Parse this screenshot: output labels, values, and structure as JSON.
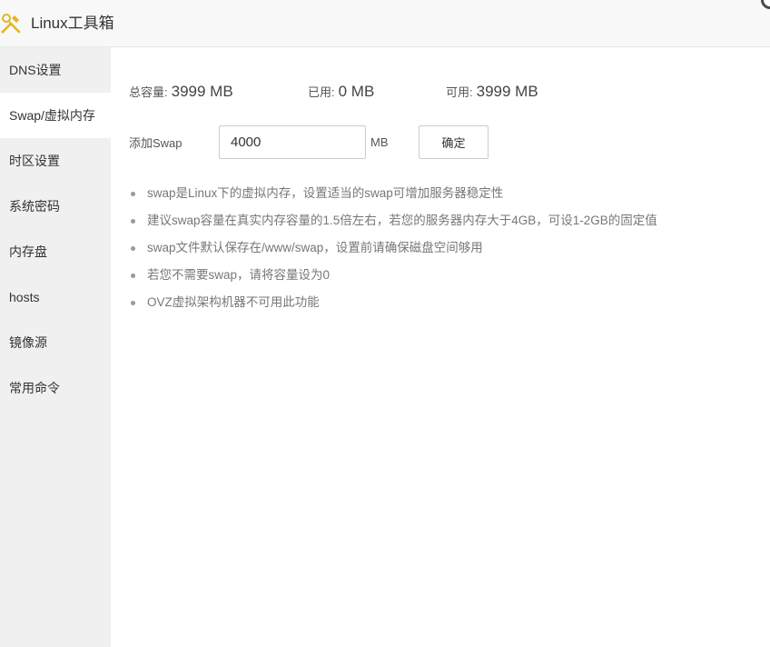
{
  "app": {
    "title": "Linux工具箱",
    "icon": "tools-icon"
  },
  "sidebar": {
    "items": [
      {
        "label": "DNS设置",
        "active": false
      },
      {
        "label": "Swap/虚拟内存",
        "active": true
      },
      {
        "label": "时区设置",
        "active": false
      },
      {
        "label": "系统密码",
        "active": false
      },
      {
        "label": "内存盘",
        "active": false
      },
      {
        "label": "hosts",
        "active": false
      },
      {
        "label": "镜像源",
        "active": false
      },
      {
        "label": "常用命令",
        "active": false
      }
    ]
  },
  "swap": {
    "stats": {
      "total_label": "总容量:",
      "total_value": "3999 MB",
      "used_label": "已用:",
      "used_value": "0 MB",
      "free_label": "可用:",
      "free_value": "3999 MB"
    },
    "form": {
      "label": "添加Swap",
      "value": "4000",
      "unit": "MB",
      "confirm_label": "确定"
    },
    "tips": [
      "swap是Linux下的虚拟内存，设置适当的swap可增加服务器稳定性",
      "建议swap容量在真实内存容量的1.5倍左右，若您的服务器内存大于4GB，可设1-2GB的固定值",
      "swap文件默认保存在/www/swap，设置前请确保磁盘空间够用",
      "若您不需要swap，请将容量设为0",
      "OVZ虚拟架构机器不可用此功能"
    ]
  },
  "colors": {
    "sidebar_bg": "#f0f0f0",
    "titlebar_bg": "#f8f8f8",
    "tip_text": "#777777",
    "icon_accent": "#e6b422"
  }
}
